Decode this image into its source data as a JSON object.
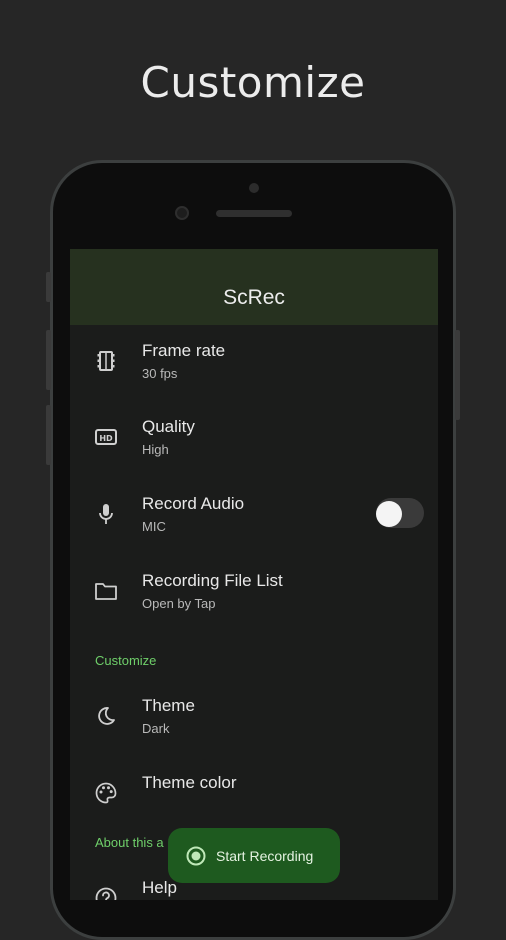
{
  "headline": "Customize",
  "app": {
    "title": "ScRec",
    "accent_color": "#6fcf6a",
    "items": [
      {
        "title": "Frame rate",
        "subtitle": "30 fps",
        "icon": "film-strip-icon"
      },
      {
        "title": "Quality",
        "subtitle": "High",
        "icon": "hd-icon"
      },
      {
        "title": "Record Audio",
        "subtitle": "MIC",
        "icon": "microphone-icon",
        "toggle_on": false
      },
      {
        "title": "Recording File List",
        "subtitle": "Open by Tap",
        "icon": "folder-icon"
      }
    ],
    "sections": {
      "customize": "Customize",
      "about": "About this a"
    },
    "customize_items": [
      {
        "title": "Theme",
        "subtitle": "Dark",
        "icon": "moon-icon"
      },
      {
        "title": "Theme color",
        "icon": "palette-icon"
      }
    ],
    "about_items": [
      {
        "title": "Help",
        "icon": "help-icon"
      }
    ],
    "fab": {
      "label": "Start Recording",
      "color": "#1e5a1f",
      "icon": "record-icon"
    }
  }
}
